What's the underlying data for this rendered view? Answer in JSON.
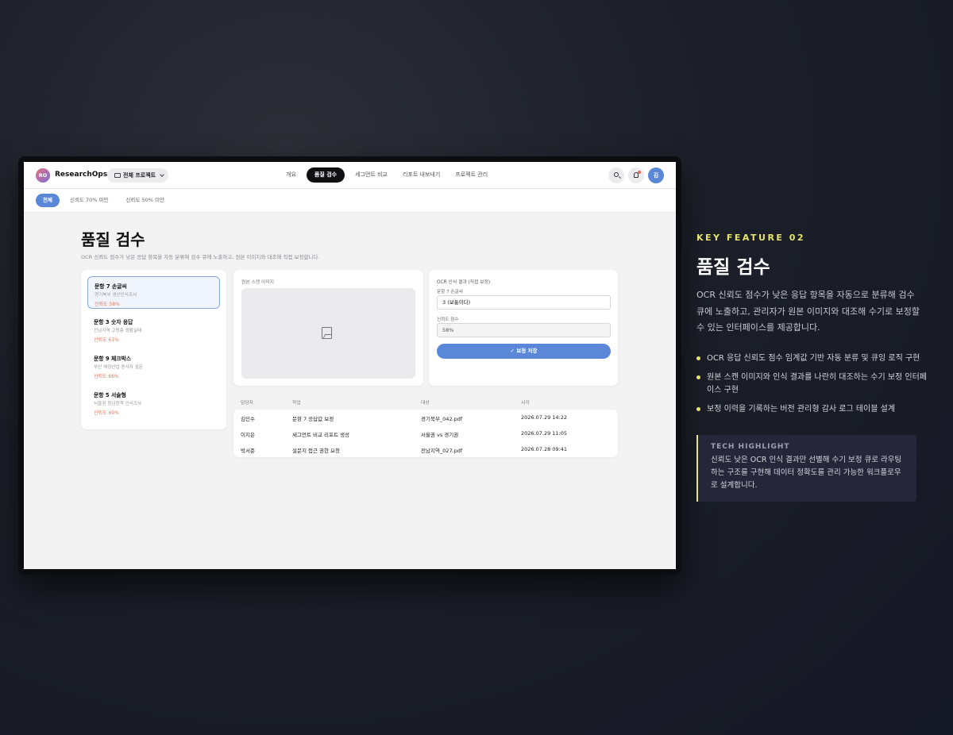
{
  "app": {
    "logo_initials": "RO",
    "name": "ResearchOps",
    "project_select": "전체 프로젝트",
    "nav_tabs": [
      "개요",
      "품질 검수",
      "세그먼트 비교",
      "리포트 내보내기",
      "프로젝트 관리"
    ],
    "active_tab": "품질 검수",
    "avatar_initial": "김",
    "filters": [
      "전체",
      "신뢰도 70% 미만",
      "신뢰도 50% 미만"
    ],
    "active_filter": "전체"
  },
  "page": {
    "title": "품질 검수",
    "description": "OCR 신뢰도 점수가 낮은 응답 항목을 자동 분류해 검수 큐에 노출하고, 원본 이미지와 대조해 직접 보정합니다."
  },
  "queue": [
    {
      "title": "문항 7 손글씨",
      "subtitle": "경기북부 생산인식조사",
      "confidence": "신뢰도 58%",
      "selected": true
    },
    {
      "title": "문항 3 숫자 응답",
      "subtitle": "전남지역 고령층 생활실태",
      "confidence": "신뢰도 61%",
      "selected": false
    },
    {
      "title": "문항 9 체크박스",
      "subtitle": "부산 해양산업 종사자 설문",
      "confidence": "신뢰도 66%",
      "selected": false
    },
    {
      "title": "문항 5 서술형",
      "subtitle": "서울권 청년정책 인식조사",
      "confidence": "신뢰도 69%",
      "selected": false
    }
  ],
  "scan": {
    "label": "원본 스캔 이미지"
  },
  "ocr": {
    "title": "OCR 인식 결과 (직접 보정)",
    "field1_label": "문항 7 손글씨",
    "field1_value": "3 (보통이다)",
    "field2_label": "신뢰도 점수",
    "field2_value": "58%",
    "save_label": "보정 저장"
  },
  "log": {
    "headers": [
      "담당자",
      "작업",
      "대상",
      "시각"
    ],
    "rows": [
      [
        "김민수",
        "문항 7 응답값 보정",
        "경기북부_042.pdf",
        "2026.07.29 14:22"
      ],
      [
        "이지은",
        "세그먼트 비교 리포트 생성",
        "서울권 vs 경기권",
        "2026.07.29 11:05"
      ],
      [
        "박서준",
        "설문지 접근 권한 요청",
        "전남지역_027.pdf",
        "2026.07.28 09:41"
      ]
    ]
  },
  "feature": {
    "kicker": "KEY FEATURE 02",
    "title": "품질 검수",
    "description": "OCR 신뢰도 점수가 낮은 응답 항목을 자동으로 분류해 검수 큐에 노출하고, 관리자가 원본 이미지와 대조해 수기로 보정할 수 있는 인터페이스를 제공합니다.",
    "bullets": [
      "OCR 응답 신뢰도 점수 임계값 기반 자동 분류 및 큐잉 로직 구현",
      "원본 스캔 이미지와 인식 결과를 나란히 대조하는 수기 보정 인터페이스 구현",
      "보정 이력을 기록하는 버전 관리형 감사 로그 테이블 설계"
    ],
    "highlight_label": "TECH HIGHLIGHT",
    "highlight_text": "신뢰도 낮은 OCR 인식 결과만 선별해 수기 보정 큐로 라우팅하는 구조를 구현해 데이터 정확도를 관리 가능한 워크플로우로 설계합니다."
  },
  "colors": {
    "accent": "#5b87d9",
    "warning": "#e6785d",
    "highlight_yellow": "#e8e36a",
    "background_dark": "#1c1f28"
  }
}
